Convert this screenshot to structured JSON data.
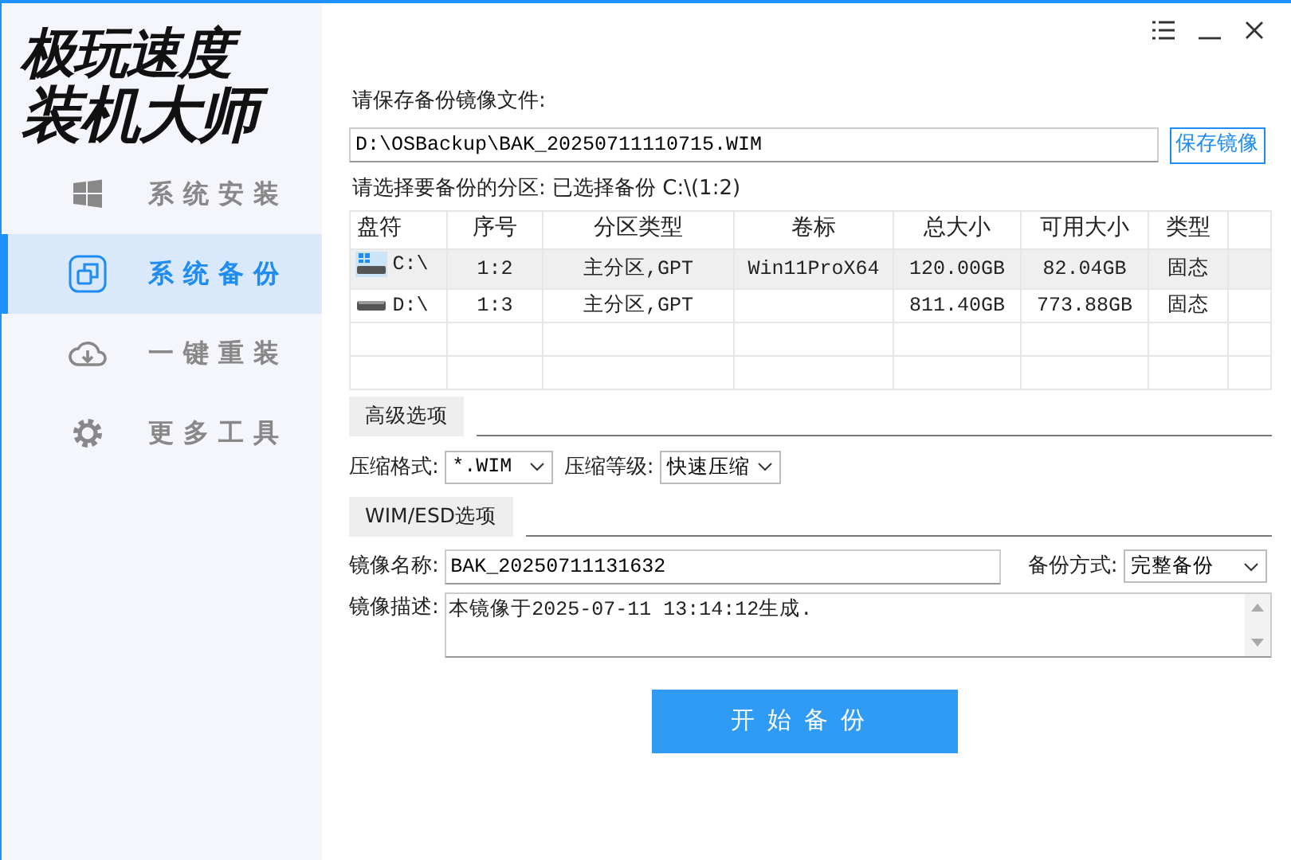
{
  "sidebar": {
    "logo": [
      "极玩速度",
      "装机大师"
    ],
    "items": [
      {
        "label": "系统安装",
        "selected": false
      },
      {
        "label": "系统备份",
        "selected": true
      },
      {
        "label": "一键重装",
        "selected": false
      },
      {
        "label": "更多工具",
        "selected": false
      }
    ]
  },
  "save": {
    "label": "请保存备份镜像文件:",
    "path": "D:\\OSBackup\\BAK_20250711110715.WIM",
    "button": "保存镜像"
  },
  "partition": {
    "label": "请选择要备份的分区: 已选择备份 C:\\(1:2)",
    "table": {
      "columns": [
        "盘符",
        "序号",
        "分区类型",
        "卷标",
        "总大小",
        "可用大小",
        "类型"
      ],
      "rows": [
        {
          "kind": "system",
          "selected": true,
          "cells": [
            "C:\\",
            "1:2",
            "主分区,GPT",
            "Win11ProX64",
            "120.00GB",
            "82.04GB",
            "固态"
          ]
        },
        {
          "kind": "data",
          "selected": false,
          "cells": [
            "D:\\",
            "1:3",
            "主分区,GPT",
            "",
            "811.40GB",
            "773.88GB",
            "固态"
          ]
        }
      ]
    }
  },
  "advanced": {
    "title": "高级选项",
    "format_label": "压缩格式:",
    "format": "*.WIM",
    "level_label": "压缩等级:",
    "level": "快速压缩"
  },
  "wim": {
    "title": "WIM/ESD选项",
    "name_label": "镜像名称:",
    "name": "BAK_20250711131632",
    "mode_label": "备份方式:",
    "mode": "完整备份",
    "desc_label": "镜像描述:",
    "desc": "本镜像于2025-07-11 13:14:12生成."
  },
  "start_button": "开始备份"
}
